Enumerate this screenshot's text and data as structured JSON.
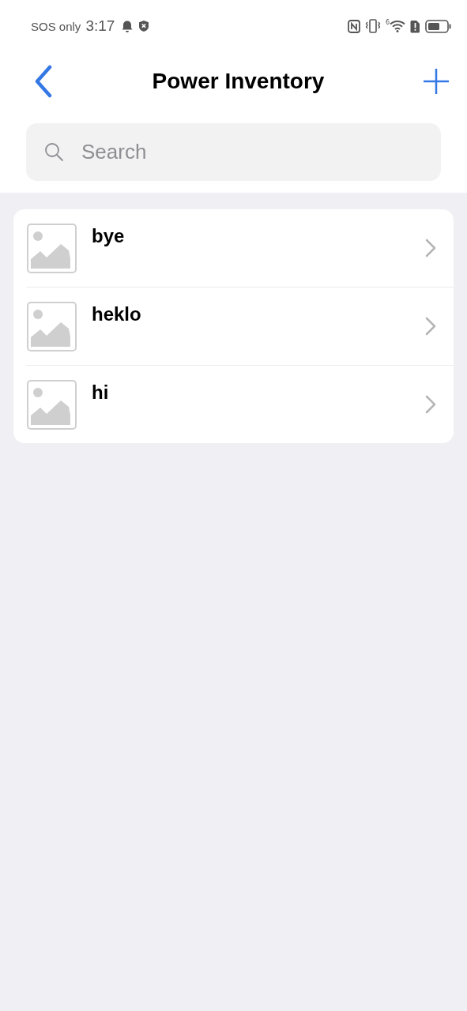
{
  "status_bar": {
    "carrier": "SOS only",
    "time": "3:17",
    "network_badge": "6"
  },
  "header": {
    "title": "Power Inventory"
  },
  "search": {
    "placeholder": "Search"
  },
  "items": [
    {
      "name": "bye"
    },
    {
      "name": "heklo"
    },
    {
      "name": "hi"
    }
  ]
}
